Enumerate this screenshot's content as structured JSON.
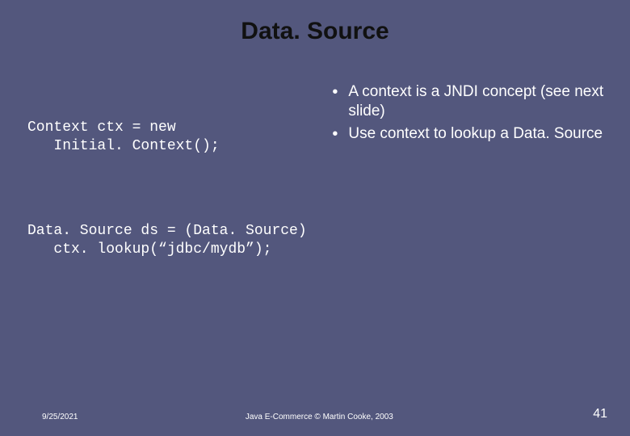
{
  "title": "Data. Source",
  "code": {
    "block1_line1": "Context ctx = new",
    "block1_line2": "   Initial. Context();",
    "block2_line1": "Data. Source ds = (Data. Source)",
    "block2_line2": "   ctx. lookup(“jdbc/mydb”);"
  },
  "bullets": [
    "A context is a JNDI concept (see next slide)",
    "Use context to lookup a Data. Source"
  ],
  "footer": {
    "date": "9/25/2021",
    "center": "Java E-Commerce © Martin Cooke, 2003",
    "page": "41"
  }
}
